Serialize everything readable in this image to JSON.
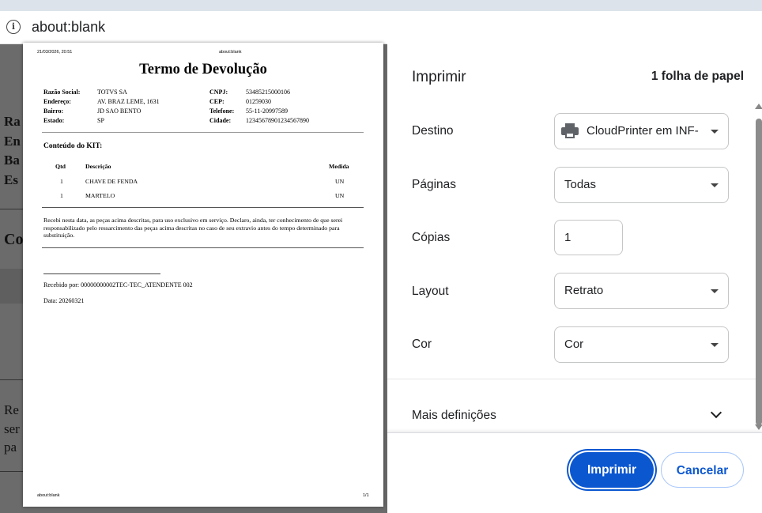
{
  "browser": {
    "url": "about:blank"
  },
  "background_page": {
    "lines": [
      "Ra",
      "En",
      "Ba",
      "Es",
      "Co",
      "Re",
      "ser",
      "pa"
    ]
  },
  "preview": {
    "header_datetime": "21/03/2026, 20:51",
    "header_url": "about:blank",
    "title": "Termo de Devolução",
    "fields_left": [
      {
        "label": "Razão Social:",
        "value": "TOTVS SA"
      },
      {
        "label": "Endereço:",
        "value": "AV. BRAZ LEME, 1631"
      },
      {
        "label": "Bairro:",
        "value": "JD SAO BENTO"
      },
      {
        "label": "Estado:",
        "value": "SP"
      }
    ],
    "fields_right": [
      {
        "label": "CNPJ:",
        "value": "53485215000106"
      },
      {
        "label": "CEP:",
        "value": "01259030"
      },
      {
        "label": "Telefone:",
        "value": "55-11-20997589"
      },
      {
        "label": "Cidade:",
        "value": "12345678901234567890"
      }
    ],
    "kit_heading": "Conteúdo do KIT:",
    "table_headers": {
      "qty": "Qtd",
      "desc": "Descrição",
      "unit": "Medida"
    },
    "items": [
      {
        "qty": "1",
        "desc": "CHAVE DE FENDA",
        "unit": "UN"
      },
      {
        "qty": "1",
        "desc": "MARTELO",
        "unit": "UN"
      }
    ],
    "declaration": "Recebi nesta data, as peças acima descritas, para uso exclusivo em serviço. Declaro, ainda, ter conhecimento de que serei responsabilizado pelo ressarcimento das peças acima descritas no caso de seu extravio antes do tempo determinado para substituição.",
    "received_by": "Recebido por: 00000000002TEC-TEC_ATENDENTE 002",
    "date": "Data: 20260321",
    "footer_url": "about:blank",
    "footer_page": "1/1"
  },
  "print_panel": {
    "title": "Imprimir",
    "sheet_count": "1 folha de papel",
    "destination_label": "Destino",
    "destination_value": "CloudPrinter em INF-",
    "pages_label": "Páginas",
    "pages_value": "Todas",
    "copies_label": "Cópias",
    "copies_value": "1",
    "layout_label": "Layout",
    "layout_value": "Retrato",
    "color_label": "Cor",
    "color_value": "Cor",
    "more_settings": "Mais definições",
    "print_button": "Imprimir",
    "cancel_button": "Cancelar"
  },
  "colors": {
    "accent": "#0b57d0",
    "backdrop": "#6b6b6b"
  }
}
